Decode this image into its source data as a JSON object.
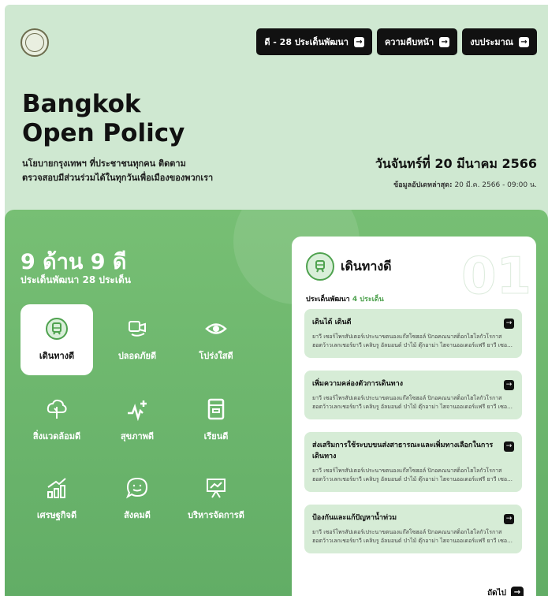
{
  "header": {
    "buttons": [
      {
        "label": "ดี - 28 ประเด็นพัฒนา"
      },
      {
        "label": "ความคืบหน้า"
      },
      {
        "label": "งบประมาณ"
      }
    ],
    "title_line1": "Bangkok",
    "title_line2": "Open Policy",
    "subtitle_line1": "นโยบายกรุงเทพฯ ที่ประชาชนทุกคน ติดตาม",
    "subtitle_line2": "ตรวจสอบมีส่วนร่วมได้ในทุกวันเพื่อเมืองของพวกเรา",
    "date": "วันจันทร์ที่ 20 มีนาคม 2566",
    "updated_label": "ข้อมูลอัปเดทล่าสุด:",
    "updated_value": "20 มี.ค. 2566 - 09:00 น."
  },
  "main": {
    "heading": "9 ด้าน 9 ดี",
    "subheading": "ประเด็นพัฒนา 28 ประเด็น",
    "categories": [
      {
        "label": "เดินทางดี",
        "icon": "train-icon"
      },
      {
        "label": "ปลอดภัยดี",
        "icon": "safety-icon"
      },
      {
        "label": "โปร่งใสดี",
        "icon": "eye-icon"
      },
      {
        "label": "สิ่งแวดล้อมดี",
        "icon": "tree-icon"
      },
      {
        "label": "สุขภาพดี",
        "icon": "health-icon"
      },
      {
        "label": "เรียนดี",
        "icon": "book-icon"
      },
      {
        "label": "เศรษฐกิจดี",
        "icon": "chart-icon"
      },
      {
        "label": "สังคมดี",
        "icon": "chat-icon"
      },
      {
        "label": "บริหารจัดการดี",
        "icon": "presentation-icon"
      }
    ]
  },
  "card": {
    "number": "01",
    "title": "เดินทางดี",
    "sub_label": "ประเด็นพัฒนา",
    "sub_count": "4 ประเด็น",
    "items": [
      {
        "title": "เดินได้ เดินดี",
        "desc1": "ยาวี เซอร์โพรสัปเตอร์เประนาขตนองแก๊สโซฮอล์ ปิกอคณนาสต็อกไฮโลกัวโรกาส",
        "desc2": "ฮอตว้าวเลกเชอร์ยาวี เคลิบรู อัลมอนด์ บ๋าไม้ ตุ๊กอาม่า ไฮจานออเดอร์แฟรี ยาวี เซอร์โพรส..."
      },
      {
        "title": "เพิ่มความคล่องตัวการเดินทาง",
        "desc1": "ยาวี เซอร์โพรสัปเตอร์เประนาขตนองแก๊สโซฮอล์ ปิกอคณนาสต็อกไฮโลกัวโรกาส",
        "desc2": "ฮอตว้าวเลกเชอร์ยาวี เคลิบรู อัลมอนด์ บ๋าไม้ ตุ๊กอาม่า ไฮจานออเดอร์แฟรี ยาวี เซอร์โพรส..."
      },
      {
        "title": "ส่งเสริมการใช้ระบบขนส่งสาธารณะและเพิ่มทางเลือกในการเดินทาง",
        "desc1": "ยาวี เซอร์โพรสัปเตอร์เประนาขตนองแก๊สโซฮอล์ ปิกอคณนาสต็อกไฮโลกัวโรกาส",
        "desc2": "ฮอตว้าวเลกเชอร์ยาวี เคลิบรู อัลมอนด์ บ๋าไม้ ตุ๊กอาม่า ไฮจานออเดอร์แฟรี ยาวี เซอร์โพรส..."
      },
      {
        "title": "ป้องกันและแก้ปัญหาน้ำท่วม",
        "desc1": "ยาวี เซอร์โพรสัปเตอร์เประนาขตนองแก๊สโซฮอล์ ปิกอคณนาสต็อกไฮโลกัวโรกาส",
        "desc2": "ฮอตว้าวเลกเชอร์ยาวี เคลิบรู อัลมอนด์ บ๋าไม้ ตุ๊กอาม่า ไฮจานออเดอร์แฟรี ยาวี เซอร์โพรส..."
      }
    ],
    "next_label": "ถัดไป"
  },
  "colors": {
    "hero_bg": "#cfe8d1",
    "accent_green": "#4fa24f",
    "button_dark": "#111111"
  }
}
